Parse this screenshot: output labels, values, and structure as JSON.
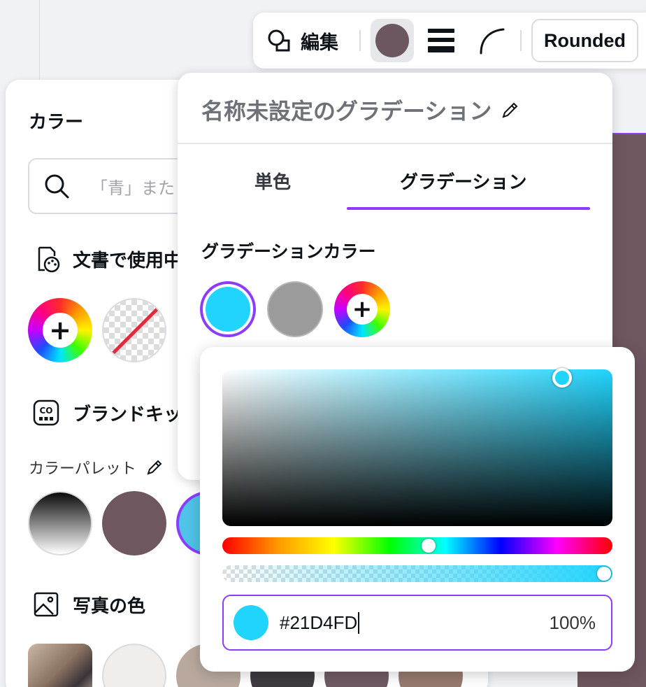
{
  "toolbar": {
    "edit_label": "編集",
    "stroke_color": "#6c5660",
    "font_label": "Rounded"
  },
  "color_panel": {
    "title": "カラー",
    "search_placeholder": "「青」また",
    "document_colors_heading": "文書で使用中",
    "brand_kit_heading": "ブランドキッ",
    "palette_label": "カラーパレット",
    "palette_colors": [
      "gradient-black-white",
      "#6f5760",
      "#4fc3e8"
    ],
    "photo_colors_heading": "写真の色",
    "photo_swatches": [
      "#f0edea",
      "#b8a89e",
      "#3e3b41",
      "#6f5a63",
      "#967a70"
    ]
  },
  "gradient_panel": {
    "title": "名称未設定のグラデーション",
    "tabs": [
      {
        "label": "単色",
        "active": false
      },
      {
        "label": "グラデーション",
        "active": true
      }
    ],
    "stops_heading": "グラデーションカラー",
    "stops": [
      "#21D4FD",
      "#9B9B9B"
    ]
  },
  "color_picker": {
    "hex": "#21D4FD",
    "opacity": "100%",
    "hue_position": 0.53,
    "alpha_value": 1.0
  }
}
